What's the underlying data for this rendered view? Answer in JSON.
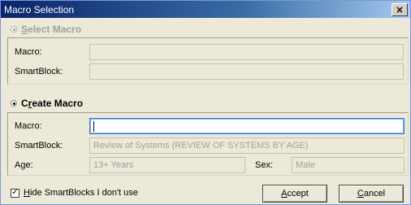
{
  "window": {
    "title": "Macro Selection",
    "close_glyph": "×"
  },
  "select_macro": {
    "label_mnemonic": "S",
    "label_rest": "elect Macro",
    "fields": [
      {
        "label": "Macro:",
        "value": ""
      },
      {
        "label": "SmartBlock:",
        "value": ""
      }
    ]
  },
  "create_macro": {
    "label_first": "C",
    "label_mnemonic": "r",
    "label_rest": "eate Macro",
    "macro_label": "Macro:",
    "macro_value": "",
    "smartblock_label": "SmartBlock:",
    "smartblock_value": "Review of Systems (REVIEW OF SYSTEMS BY AGE)",
    "age_label": "Age:",
    "age_value": "13+ Years",
    "sex_label": "Sex:",
    "sex_value": "Male"
  },
  "footer": {
    "hide_checkbox_checked": true,
    "hide_mnemonic": "H",
    "hide_rest": "ide SmartBlocks I don't use",
    "accept_mnemonic": "A",
    "accept_rest": "ccept",
    "cancel_mnemonic": "C",
    "cancel_rest": "ancel",
    "check_glyph": "✓"
  },
  "colors": {
    "titlebar_start": "#0a246a",
    "titlebar_end": "#a6caf0",
    "face": "#ece9d8",
    "focus": "#3a7bd5"
  }
}
